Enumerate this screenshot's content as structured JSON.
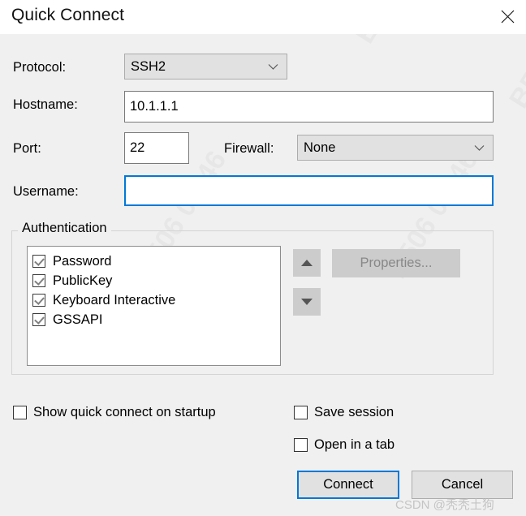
{
  "window": {
    "title": "Quick Connect",
    "close_icon": "close-icon"
  },
  "form": {
    "protocol": {
      "label": "Protocol:",
      "value": "SSH2",
      "chevron_icon": "chevron-down-icon"
    },
    "hostname": {
      "label": "Hostname:",
      "value": "10.1.1.1",
      "placeholder": ""
    },
    "port": {
      "label": "Port:",
      "value": "22",
      "placeholder": ""
    },
    "firewall": {
      "label": "Firewall:",
      "value": "None",
      "chevron_icon": "chevron-down-icon"
    },
    "username": {
      "label": "Username:",
      "value": "",
      "placeholder": ""
    }
  },
  "authentication": {
    "group_title": "Authentication",
    "items": [
      {
        "label": "Password",
        "checked": true
      },
      {
        "label": "PublicKey",
        "checked": true
      },
      {
        "label": "Keyboard Interactive",
        "checked": true
      },
      {
        "label": "GSSAPI",
        "checked": true
      }
    ],
    "move_up_icon": "arrow-up-icon",
    "move_down_icon": "arrow-down-icon",
    "properties_button": {
      "label": "Properties...",
      "enabled": false
    }
  },
  "options": [
    {
      "label": "Show quick connect on startup",
      "checked": false
    },
    {
      "label": "Save session",
      "checked": false
    },
    {
      "label": "Open in a tab",
      "checked": false
    }
  ],
  "actions": {
    "connect": "Connect",
    "cancel": "Cancel"
  },
  "watermark": {
    "text": "CSDN @秃秃土狗",
    "background_fragments": [
      "B506 09:46",
      "B506 09:46",
      "B506 09:46",
      "B506 09:46"
    ]
  },
  "colors": {
    "accent": "#0078d7",
    "dialog_background": "#f0f0f0",
    "titlebar_background": "#ffffff",
    "field_background": "#ffffff",
    "combo_background": "#e1e1e1",
    "disabled_button": "#cccccc",
    "watermark": "#c4c4c4"
  }
}
